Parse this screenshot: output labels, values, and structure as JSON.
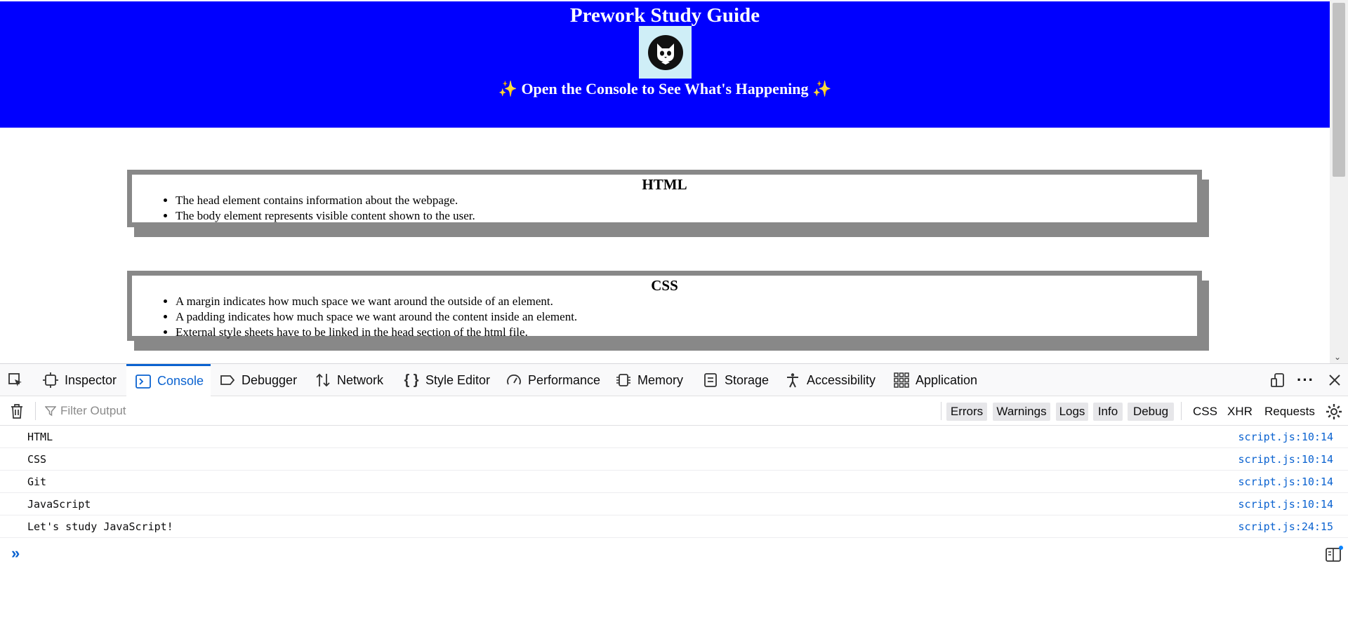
{
  "page": {
    "title": "Prework Study Guide",
    "subtitle": "✨ Open the Console to See What's Happening ✨",
    "header_color": "#0000ff"
  },
  "cards": [
    {
      "heading": "HTML",
      "items": [
        "The head element contains information about the webpage.",
        "The body element represents visible content shown to the user."
      ]
    },
    {
      "heading": "CSS",
      "items": [
        "A margin indicates how much space we want around the outside of an element.",
        "A padding indicates how much space we want around the content inside an element.",
        "External style sheets have to be linked in the head section of the html file."
      ]
    }
  ],
  "devtools": {
    "tabs": [
      {
        "label": "Inspector",
        "icon": "inspector-icon"
      },
      {
        "label": "Console",
        "icon": "console-icon",
        "active": true
      },
      {
        "label": "Debugger",
        "icon": "debugger-icon"
      },
      {
        "label": "Network",
        "icon": "network-icon"
      },
      {
        "label": "Style Editor",
        "icon": "style-editor-icon"
      },
      {
        "label": "Performance",
        "icon": "performance-icon"
      },
      {
        "label": "Memory",
        "icon": "memory-icon"
      },
      {
        "label": "Storage",
        "icon": "storage-icon"
      },
      {
        "label": "Accessibility",
        "icon": "accessibility-icon"
      },
      {
        "label": "Application",
        "icon": "application-icon"
      }
    ],
    "filter_placeholder": "Filter Output",
    "filter_buttons": [
      "Errors",
      "Warnings",
      "Logs",
      "Info",
      "Debug"
    ],
    "filter_plain": [
      "CSS",
      "XHR",
      "Requests"
    ],
    "logs": [
      {
        "message": "HTML",
        "source": "script.js:10:14"
      },
      {
        "message": "CSS",
        "source": "script.js:10:14"
      },
      {
        "message": "Git",
        "source": "script.js:10:14"
      },
      {
        "message": "JavaScript",
        "source": "script.js:10:14"
      },
      {
        "message": "Let's study JavaScript!",
        "source": "script.js:24:15"
      }
    ],
    "accent_color": "#0a62d0"
  }
}
